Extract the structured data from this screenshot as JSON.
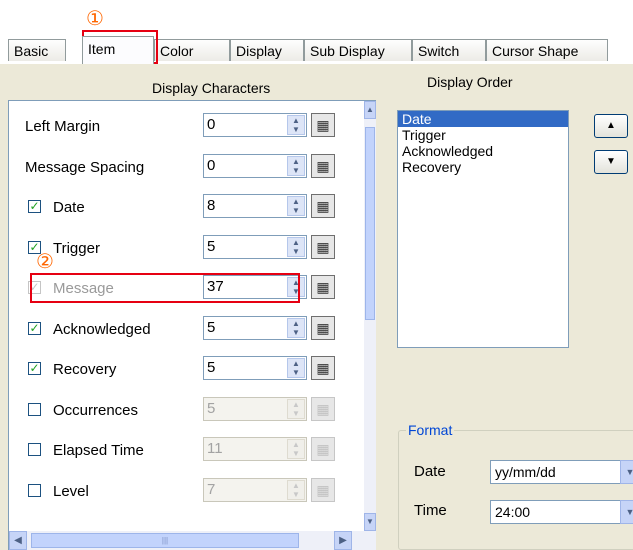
{
  "tabs": [
    "Basic",
    "Item",
    "Color",
    "Display",
    "Sub Display",
    "Switch",
    "Cursor Shape"
  ],
  "markers": {
    "one": "①",
    "two": "②"
  },
  "headers": {
    "display_characters": "Display Characters",
    "display_order": "Display Order"
  },
  "rows": [
    {
      "label": "Left Margin",
      "checkbox": null,
      "value": "0",
      "enabled": true
    },
    {
      "label": "Message Spacing",
      "checkbox": null,
      "value": "0",
      "enabled": true
    },
    {
      "label": "Date",
      "checkbox": "checked",
      "value": "8",
      "enabled": true
    },
    {
      "label": "Trigger",
      "checkbox": "checked",
      "value": "5",
      "enabled": true
    },
    {
      "label": "Message",
      "checkbox": "checked-dim",
      "value": "37",
      "enabled": true
    },
    {
      "label": "Acknowledged",
      "checkbox": "checked",
      "value": "5",
      "enabled": true
    },
    {
      "label": "Recovery",
      "checkbox": "checked",
      "value": "5",
      "enabled": true
    },
    {
      "label": "Occurrences",
      "checkbox": "unchecked",
      "value": "5",
      "enabled": false
    },
    {
      "label": "Elapsed Time",
      "checkbox": "unchecked",
      "value": "11",
      "enabled": false
    },
    {
      "label": "Level",
      "checkbox": "unchecked",
      "value": "7",
      "enabled": false
    }
  ],
  "display_order": [
    "Date",
    "Trigger",
    "Acknowledged",
    "Recovery"
  ],
  "display_order_selected": "Date",
  "format": {
    "title": "Format",
    "date_label": "Date",
    "date_value": "yy/mm/dd",
    "time_label": "Time",
    "time_value": "24:00"
  },
  "colors": {
    "highlight": "#e60012",
    "marker": "#ff6600",
    "selection": "#316ac5",
    "panel": "#ece9d8"
  },
  "icons": {
    "spin": "spinner-icon",
    "calc": "calculator-icon",
    "up": "arrow-up-icon",
    "down": "arrow-down-icon"
  }
}
